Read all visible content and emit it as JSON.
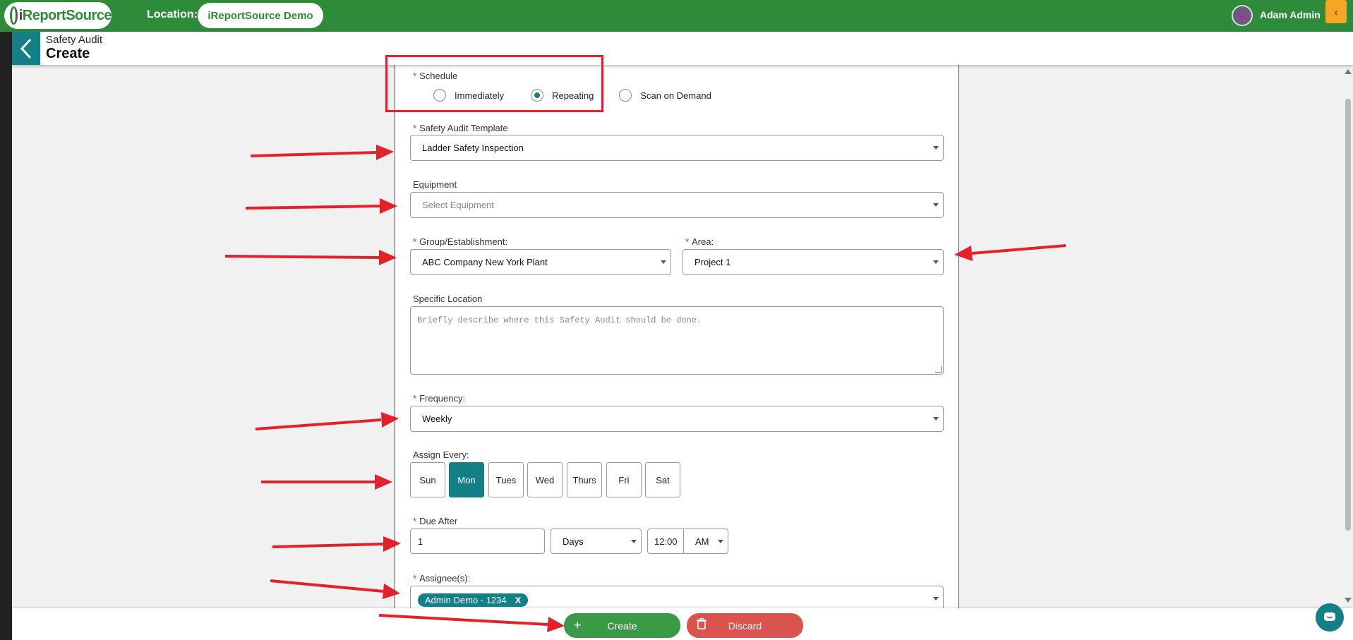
{
  "topbar": {
    "logo_text_left": "i",
    "logo_text_right": "ReportSource",
    "location_label": "Location:",
    "location_value": "iReportSource Demo",
    "user_name": "Adam Admin",
    "collapse_glyph": "‹"
  },
  "header": {
    "module": "Safety Audit",
    "title": "Create"
  },
  "form": {
    "schedule": {
      "label": "Schedule",
      "options": [
        "Immediately",
        "Repeating",
        "Scan on Demand"
      ],
      "selected": "Repeating"
    },
    "template": {
      "label": "Safety Audit Template",
      "value": "Ladder Safety Inspection"
    },
    "equipment": {
      "label": "Equipment",
      "placeholder": "Select Equipment"
    },
    "group": {
      "label": "Group/Establishment:",
      "value": "ABC Company New York Plant"
    },
    "area": {
      "label": "Area:",
      "value": "Project 1"
    },
    "specific_location": {
      "label": "Specific Location",
      "placeholder": "Briefly describe where this Safety Audit should be done."
    },
    "frequency": {
      "label": "Frequency:",
      "value": "Weekly"
    },
    "assign_every": {
      "label": "Assign Every:",
      "days": [
        "Sun",
        "Mon",
        "Tues",
        "Wed",
        "Thurs",
        "Fri",
        "Sat"
      ],
      "selected": "Mon"
    },
    "due_after": {
      "label": "Due After",
      "amount": "1",
      "unit": "Days",
      "time": "12:00",
      "ampm": "AM"
    },
    "assignees": {
      "label": "Assignee(s):",
      "tags": [
        "Admin Demo - 1234"
      ],
      "remove_glyph": "X"
    }
  },
  "footer": {
    "create_label": "Create",
    "discard_label": "Discard"
  },
  "colors": {
    "brand_green": "#2e8b3a",
    "teal": "#137f87",
    "danger": "#d9534f",
    "annotation_red": "#e3212b"
  }
}
